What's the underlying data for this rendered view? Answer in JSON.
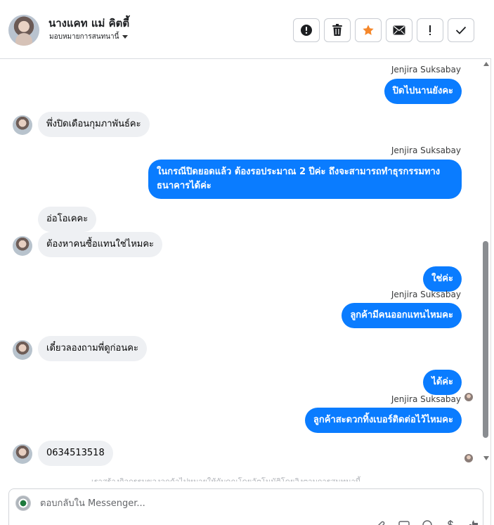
{
  "header": {
    "name": "นางแคท แม่ คิตตี้",
    "assign_label": "มอบหมายการสนทนานี้",
    "actions": [
      {
        "name": "report-spam-button",
        "icon": "alert-circle-icon"
      },
      {
        "name": "delete-button",
        "icon": "trash-icon"
      },
      {
        "name": "star-button",
        "icon": "star-icon"
      },
      {
        "name": "mark-unread-button",
        "icon": "envelope-icon"
      },
      {
        "name": "follow-up-button",
        "icon": "exclamation-icon"
      },
      {
        "name": "mark-done-button",
        "icon": "check-icon"
      }
    ],
    "colors": {
      "star": "#f5872a"
    }
  },
  "messages": [
    {
      "sender": "Jenjira Suksabay",
      "text": "ปิดไปนานยังคะ",
      "dir": "out"
    },
    {
      "text": "พึ่งปิดเดือนกุมภาพันธ์คะ",
      "dir": "in"
    },
    {
      "sender": "Jenjira Suksabay",
      "text": "ในกรณีปิดยอดแล้ว ต้องรอประมาณ 2 ปีค่ะ ถึงจะสามารถทำธุรกรรมทาง ธนาคารได้ค่ะ",
      "dir": "out"
    },
    {
      "text": "อ่อโอเคคะ",
      "dir": "in"
    },
    {
      "text": "ต้องหาคนซื้อแทนใช่ไหมคะ",
      "dir": "in"
    },
    {
      "text": "ใช่ค่ะ",
      "dir": "out"
    },
    {
      "sender": "Jenjira Suksabay",
      "text": "ลูกค้ามีคนออกแทนไหมคะ",
      "dir": "out"
    },
    {
      "text": "เดี๋ยวลองถามพี่ดูก่อนคะ",
      "dir": "in"
    },
    {
      "text": "ได้ค่ะ",
      "dir": "out"
    },
    {
      "sender": "Jenjira Suksabay",
      "text": "ลูกค้าสะดวกทิ้งเบอร์ติดต่อไว้ไหมคะ",
      "dir": "out"
    },
    {
      "text": "0634513518",
      "dir": "in"
    }
  ],
  "fade_note": "เราสร้างกิจกรรมของลูกค้าไปหมายให้กับคุณโดยอัตโนมัติโดยอิงตามการสนทนานี้",
  "composer": {
    "placeholder": "ตอบกลับใน Messenger...",
    "tools": [
      "attachment-icon",
      "gif-icon",
      "emoji-icon",
      "payment-icon",
      "like-icon"
    ]
  },
  "colors": {
    "outgoing_bubble": "#0a7cff",
    "incoming_bubble": "#eef0f3"
  }
}
